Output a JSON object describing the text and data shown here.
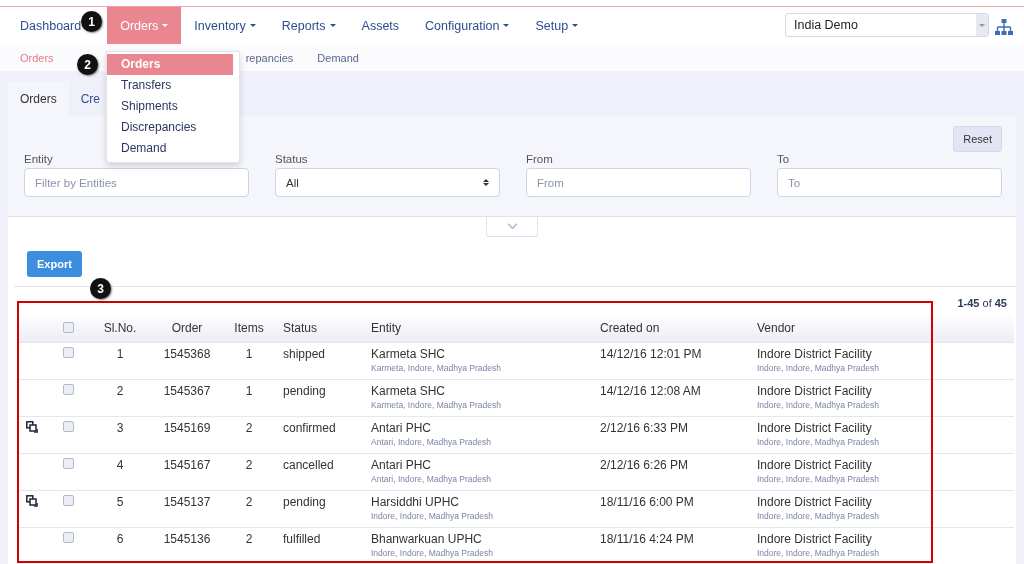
{
  "nav": {
    "items": [
      {
        "label": "Dashboard",
        "has_menu": false,
        "selected": false
      },
      {
        "label": "Orders",
        "has_menu": true,
        "selected": true
      },
      {
        "label": "Inventory",
        "has_menu": true,
        "selected": false
      },
      {
        "label": "Reports",
        "has_menu": true,
        "selected": false
      },
      {
        "label": "Assets",
        "has_menu": false,
        "selected": false
      },
      {
        "label": "Configuration",
        "has_menu": true,
        "selected": false
      },
      {
        "label": "Setup",
        "has_menu": true,
        "selected": false
      }
    ],
    "domain": "India Demo"
  },
  "orders_menu": [
    {
      "label": "Orders",
      "selected": true
    },
    {
      "label": "Transfers",
      "selected": false
    },
    {
      "label": "Shipments",
      "selected": false
    },
    {
      "label": "Discrepancies",
      "selected": false
    },
    {
      "label": "Demand",
      "selected": false
    }
  ],
  "subnav": [
    {
      "label": "Orders",
      "selected": true
    },
    {
      "label": "repancies",
      "selected": false
    },
    {
      "label": "Demand",
      "selected": false
    }
  ],
  "tabs": [
    {
      "label": "Orders",
      "selected": true
    },
    {
      "label": "Cre",
      "selected": false
    }
  ],
  "filters": {
    "reset": "Reset",
    "fields": [
      {
        "label": "Entity",
        "kind": "text",
        "placeholder": "Filter by Entities"
      },
      {
        "label": "Status",
        "kind": "select",
        "value": "All"
      },
      {
        "label": "From",
        "kind": "text",
        "placeholder": "From"
      },
      {
        "label": "To",
        "kind": "text",
        "placeholder": "To"
      }
    ]
  },
  "export": "Export",
  "pagination": "**1-45** of **45**",
  "table": {
    "all_checked": false,
    "columns": [
      "Sl.No.",
      "Order",
      "Items",
      "Status",
      "Entity",
      "Created on",
      "Vendor"
    ],
    "rows": [
      {
        "linked": false,
        "checked": false,
        "sl": "1",
        "order": "1545368",
        "items": "1",
        "status": "shipped",
        "entity": "Karmeta SHC",
        "entity_location": "Karmeta, Indore, Madhya Pradesh",
        "created": "14/12/16 12:01 PM",
        "vendor": "Indore District Facility",
        "vendor_location": "Indore, Indore, Madhya Pradesh"
      },
      {
        "linked": false,
        "checked": false,
        "sl": "2",
        "order": "1545367",
        "items": "1",
        "status": "pending",
        "entity": "Karmeta SHC",
        "entity_location": "Karmeta, Indore, Madhya Pradesh",
        "created": "14/12/16 12:08 AM",
        "vendor": "Indore District Facility",
        "vendor_location": "Indore, Indore, Madhya Pradesh"
      },
      {
        "linked": true,
        "checked": false,
        "sl": "3",
        "order": "1545169",
        "items": "2",
        "status": "confirmed",
        "entity": "Antari PHC",
        "entity_location": "Antari, Indore, Madhya Pradesh",
        "created": "2/12/16 6:33 PM",
        "vendor": "Indore District Facility",
        "vendor_location": "Indore, Indore, Madhya Pradesh"
      },
      {
        "linked": false,
        "checked": false,
        "sl": "4",
        "order": "1545167",
        "items": "2",
        "status": "cancelled",
        "entity": "Antari PHC",
        "entity_location": "Antari, Indore, Madhya Pradesh",
        "created": "2/12/16 6:26 PM",
        "vendor": "Indore District Facility",
        "vendor_location": "Indore, Indore, Madhya Pradesh"
      },
      {
        "linked": true,
        "checked": false,
        "sl": "5",
        "order": "1545137",
        "items": "2",
        "status": "pending",
        "entity": "Harsiddhi UPHC",
        "entity_location": "Indore, Indore, Madhya Pradesh",
        "created": "18/11/16 6:00 PM",
        "vendor": "Indore District Facility",
        "vendor_location": "Indore, Indore, Madhya Pradesh"
      },
      {
        "linked": false,
        "checked": false,
        "sl": "6",
        "order": "1545136",
        "items": "2",
        "status": "fulfilled",
        "entity": "Bhanwarkuan UPHC",
        "entity_location": "Indore, Indore, Madhya Pradesh",
        "created": "18/11/16 4:24 PM",
        "vendor": "Indore District Facility",
        "vendor_location": "Indore, Indore, Madhya Pradesh"
      }
    ]
  },
  "callouts": [
    {
      "label": "1",
      "kind": "nav"
    },
    {
      "label": "2",
      "kind": "menu"
    },
    {
      "label": "3",
      "kind": "table"
    }
  ]
}
